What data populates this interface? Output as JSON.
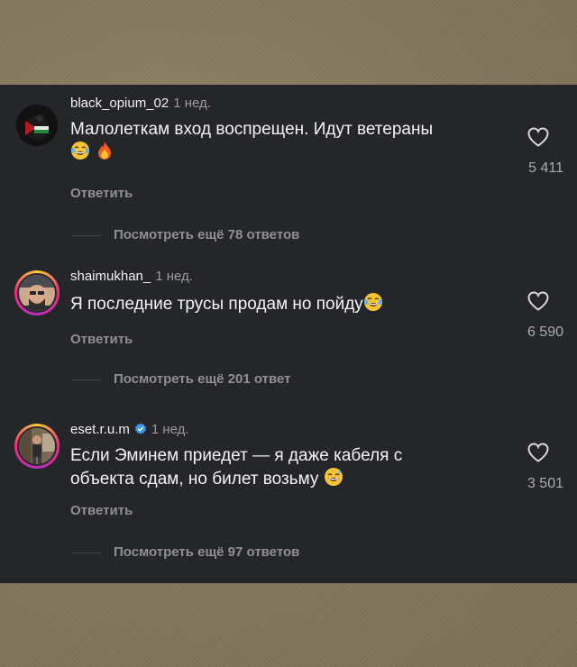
{
  "comments": [
    {
      "username": "black_opium_02",
      "time": "1 нед.",
      "text": "Малолеткам вход воспрещен. Идут ветераны",
      "emoji": [
        "laughing-tears",
        "fire"
      ],
      "likes": "5 411",
      "reply_label": "Ответить",
      "more_replies": "Посмотреть ещё 78 ответов",
      "verified": false
    },
    {
      "username": "shaimukhan_",
      "time": "1 нед.",
      "text": "Я последние трусы продам но пойду",
      "emoji": [
        "laughing-tears"
      ],
      "likes": "6 590",
      "reply_label": "Ответить",
      "more_replies": "Посмотреть ещё 201 ответ",
      "verified": false
    },
    {
      "username": "eset.r.u.m",
      "time": "1 нед.",
      "text": "Если Эминем приедет — я даже кабеля с объекта сдам, но билет возьму",
      "emoji": [
        "sweat-smile"
      ],
      "likes": "3 501",
      "reply_label": "Ответить",
      "more_replies": "Посмотреть ещё 97 ответов",
      "verified": true
    }
  ],
  "icons": {
    "like": "heart-outline-icon",
    "verified": "verified-badge-icon"
  },
  "colors": {
    "background_panel": "#25262a",
    "text_primary": "#f2f2f2",
    "text_secondary": "#8f9094",
    "verified_blue": "#3897f0",
    "backdrop": "#8a7c63"
  }
}
